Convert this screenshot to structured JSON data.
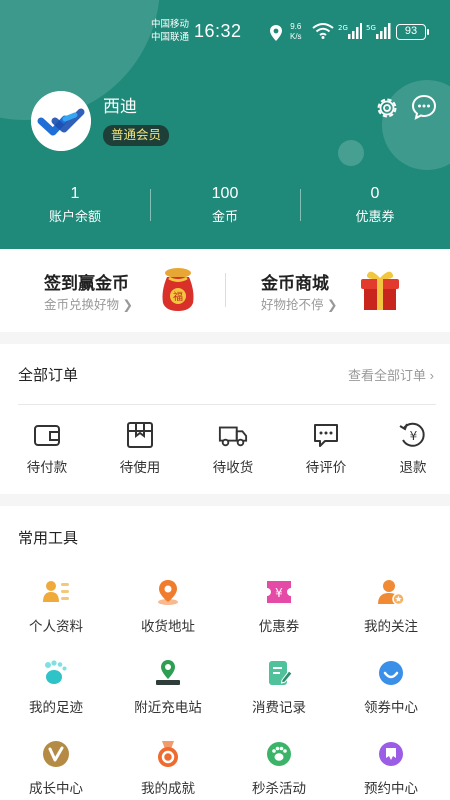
{
  "status_bar": {
    "carrier_1": "中国移动",
    "carrier_2": "中国联通",
    "time": "16:32",
    "speed_value": "9.6",
    "speed_unit": "K/s",
    "battery": "93"
  },
  "profile": {
    "name": "西迪",
    "member_level": "普通会员"
  },
  "stats": [
    {
      "value": "1",
      "label": "账户余额"
    },
    {
      "value": "100",
      "label": "金币"
    },
    {
      "value": "0",
      "label": "优惠券"
    }
  ],
  "promo": {
    "left": {
      "title": "签到赢金币",
      "subtitle": "金币兑换好物"
    },
    "right": {
      "title": "金币商城",
      "subtitle": "好物抢不停"
    }
  },
  "orders": {
    "title": "全部订单",
    "view_all": "查看全部订单",
    "items": [
      {
        "label": "待付款",
        "icon": "wallet-icon"
      },
      {
        "label": "待使用",
        "icon": "package-icon"
      },
      {
        "label": "待收货",
        "icon": "truck-icon"
      },
      {
        "label": "待评价",
        "icon": "comment-icon"
      },
      {
        "label": "退款",
        "icon": "refund-icon"
      }
    ]
  },
  "tools": {
    "title": "常用工具",
    "items": [
      {
        "label": "个人资料",
        "icon": "profile-card-icon"
      },
      {
        "label": "收货地址",
        "icon": "location-pin-icon"
      },
      {
        "label": "优惠券",
        "icon": "coupon-icon"
      },
      {
        "label": "我的关注",
        "icon": "follow-user-icon"
      },
      {
        "label": "我的足迹",
        "icon": "footprint-icon"
      },
      {
        "label": "附近充电站",
        "icon": "charging-station-icon"
      },
      {
        "label": "消费记录",
        "icon": "record-edit-icon"
      },
      {
        "label": "领券中心",
        "icon": "smile-icon"
      },
      {
        "label": "成长中心",
        "icon": "growth-v-icon"
      },
      {
        "label": "我的成就",
        "icon": "medal-icon"
      },
      {
        "label": "秒杀活动",
        "icon": "paw-icon"
      },
      {
        "label": "预约中心",
        "icon": "appointment-icon"
      }
    ]
  },
  "colors": {
    "header_bg": "#1f8a7a",
    "badge_bg": "#1d3f38",
    "badge_text": "#f3e27a"
  }
}
